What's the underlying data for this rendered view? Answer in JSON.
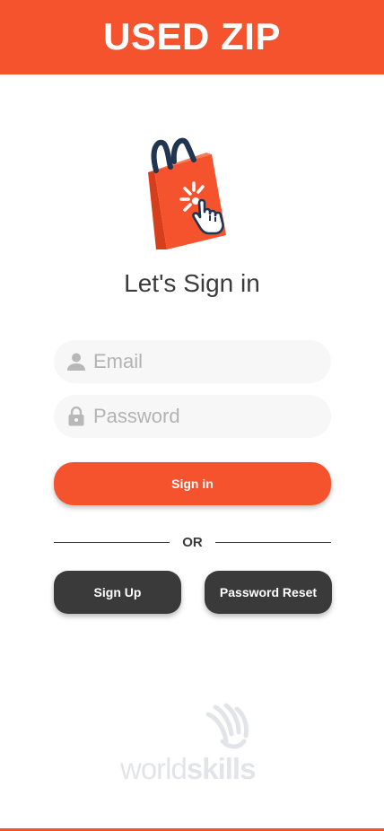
{
  "header": {
    "title": "USED ZIP"
  },
  "heading": "Let's Sign in",
  "form": {
    "email_placeholder": "Email",
    "password_placeholder": "Password"
  },
  "buttons": {
    "sign_in": "Sign in",
    "sign_up": "Sign Up",
    "password_reset": "Password Reset"
  },
  "divider": {
    "text": "OR"
  },
  "footer_logo": {
    "part1": "world",
    "part2": "skills"
  },
  "colors": {
    "brand": "#F4532D",
    "dark_button": "#3a3a3a",
    "field_bg": "#f7f7f7",
    "icon_navy": "#1f3552"
  },
  "icons": [
    "shopping-bag-icon",
    "pointer-hand-icon",
    "person-icon",
    "lock-icon",
    "worldskills-logo"
  ]
}
